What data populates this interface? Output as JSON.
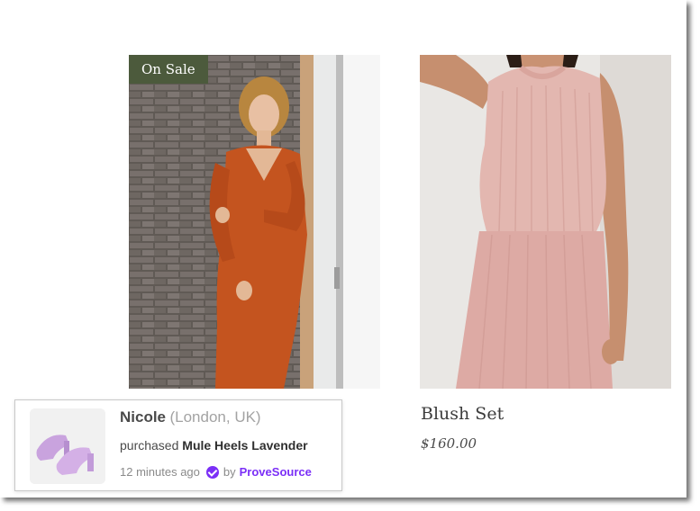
{
  "colors": {
    "sale_badge_bg": "#4c5a3c",
    "brand_purple": "#7b2ff7",
    "verified_purple": "#7b2ff7"
  },
  "products": [
    {
      "image": "woman-in-rust-wrap-dress-photo",
      "badge": "On Sale",
      "title": "",
      "price": ""
    },
    {
      "image": "woman-in-pink-knit-set-photo",
      "badge": "",
      "title": "Blush Set",
      "price": "$160.00"
    }
  ],
  "notification": {
    "thumbnail": "lavender-mule-heels-photo",
    "customer_name": "Nicole",
    "location": "(London, UK)",
    "action_text": "purchased",
    "product_name": "Mule Heels Lavender",
    "time_ago": "12 minutes ago",
    "by_text": "by",
    "brand": "ProveSource",
    "verified_icon": "verified-check-icon"
  }
}
